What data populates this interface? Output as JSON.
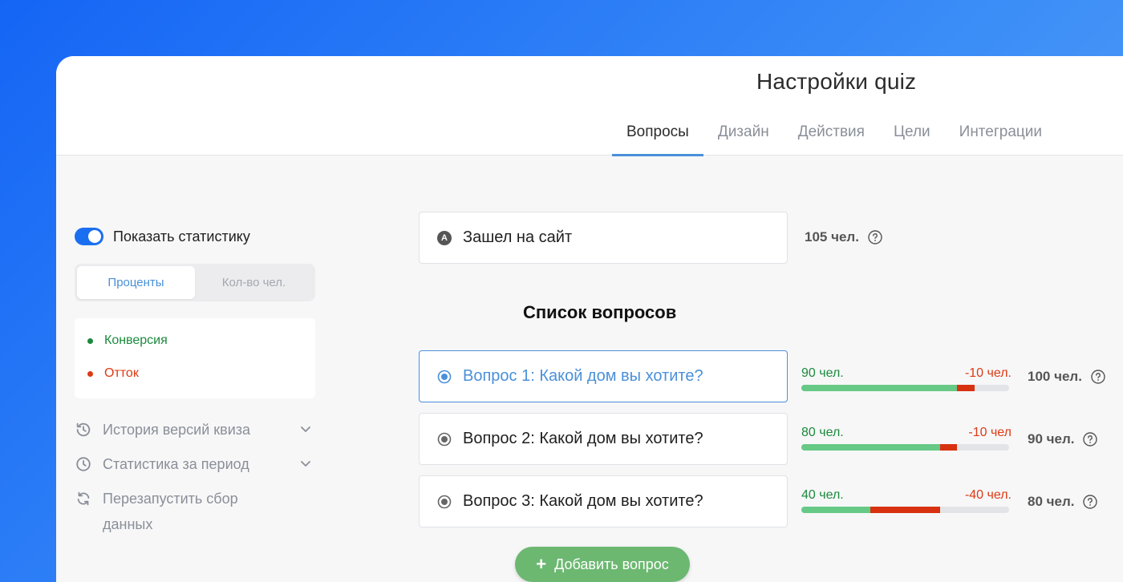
{
  "header": {
    "title": "Настройки quiz",
    "tabs": [
      {
        "label": "Вопросы",
        "active": true
      },
      {
        "label": "Дизайн",
        "active": false
      },
      {
        "label": "Действия",
        "active": false
      },
      {
        "label": "Цели",
        "active": false
      },
      {
        "label": "Интеграции",
        "active": false
      }
    ]
  },
  "sidebar": {
    "toggle_label": "Показать статистику",
    "toggle_on": true,
    "segments": [
      {
        "label": "Проценты",
        "active": true
      },
      {
        "label": "Кол-во чел.",
        "active": false
      }
    ],
    "legend": [
      {
        "label": "Конверсия",
        "color": "#1b8a3c"
      },
      {
        "label": "Отток",
        "color": "#dd3a14"
      }
    ],
    "links": [
      {
        "label": "История версий квиза",
        "icon": "history-icon",
        "expandable": true
      },
      {
        "label": "Статистика за период",
        "icon": "clock-icon",
        "expandable": true
      },
      {
        "label": "Перезапустить сбор данных",
        "icon": "restart-icon",
        "expandable": false
      }
    ]
  },
  "entry": {
    "badge": "A",
    "label": "Зашел на сайт",
    "count": "105 чел."
  },
  "list_title": "Список вопросов",
  "questions": [
    {
      "label": "Вопрос 1: Какой дом вы хотите?",
      "selected": true,
      "conversion": "90 чел.",
      "churn": "-10 чел.",
      "total": "100 чел.",
      "conversion_value": 90,
      "churn_value": 10
    },
    {
      "label": "Вопрос 2: Какой дом вы хотите?",
      "selected": false,
      "conversion": "80 чел.",
      "churn": "-10 чел",
      "total": "90 чел.",
      "conversion_value": 80,
      "churn_value": 10
    },
    {
      "label": "Вопрос 3: Какой дом вы хотите?",
      "selected": false,
      "conversion": "40 чел.",
      "churn": "-40 чел.",
      "total": "80 чел.",
      "conversion_value": 40,
      "churn_value": 40
    }
  ],
  "bar_scale_max": 120,
  "add_button": {
    "label": "Добавить вопрос"
  },
  "colors": {
    "accent": "#4a90d9",
    "toggle": "#1a6ff0",
    "conversion": "#66c985",
    "churn": "#d8310f",
    "add_button": "#6cb871"
  }
}
